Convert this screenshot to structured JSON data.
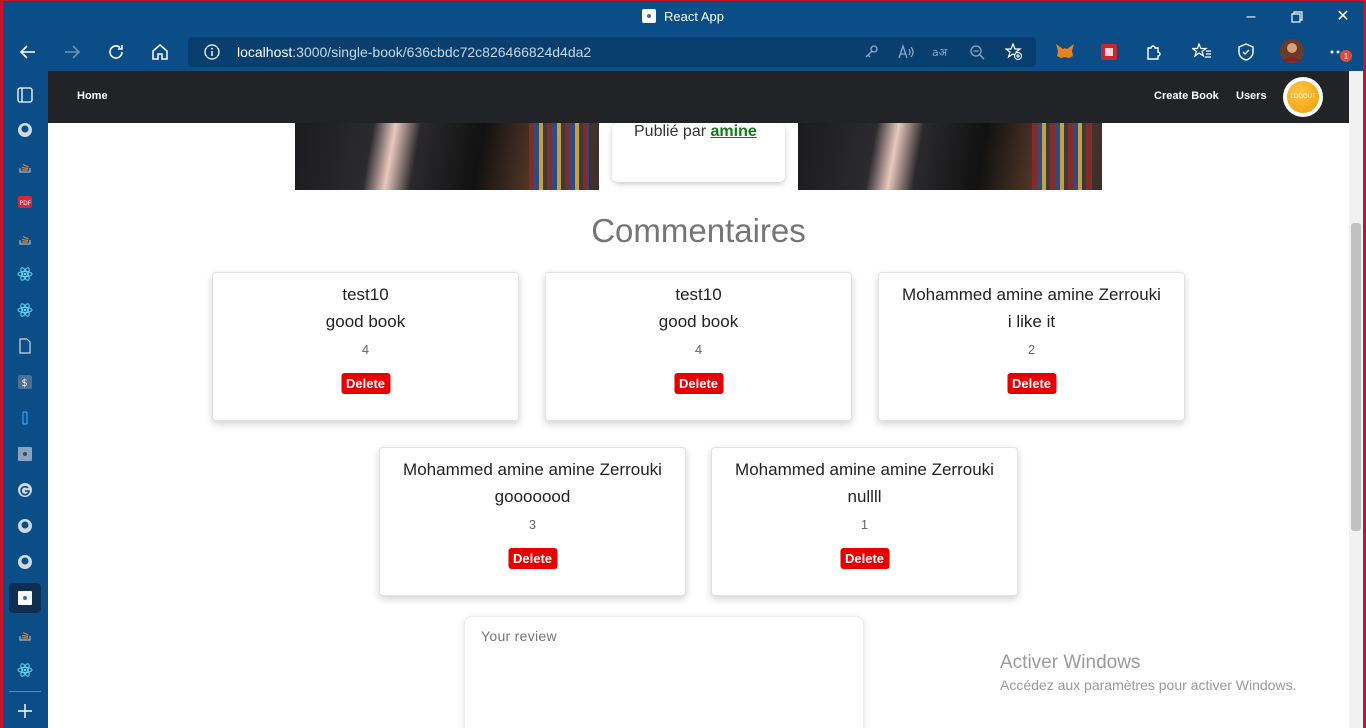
{
  "browser": {
    "window_title": "React App",
    "url_host": "localhost",
    "url_rest": ":3000/single-book/636cbdc72c826466824d4da2",
    "notification_count": "1"
  },
  "app": {
    "nav": {
      "home": "Home",
      "create_book": "Create Book",
      "users": "Users",
      "logout": "LOGOUT"
    },
    "book": {
      "published_prefix": "Publié par",
      "author": "amine"
    },
    "comments_title": "Commentaires",
    "comments": [
      {
        "author": "test10",
        "text": "good book",
        "rating": "4",
        "delete_label": "Delete"
      },
      {
        "author": "test10",
        "text": "good book",
        "rating": "4",
        "delete_label": "Delete"
      },
      {
        "author": "Mohammed amine amine Zerrouki",
        "text": "i like it",
        "rating": "2",
        "delete_label": "Delete"
      },
      {
        "author": "Mohammed amine amine Zerrouki",
        "text": "gooooood",
        "rating": "3",
        "delete_label": "Delete"
      },
      {
        "author": "Mohammed amine amine Zerrouki",
        "text": "nullll",
        "rating": "1",
        "delete_label": "Delete"
      }
    ],
    "review_placeholder": "Your review"
  },
  "watermark": {
    "line1": "Activer Windows",
    "line2": "Accédez aux paramètres pour activer Windows."
  },
  "colors": {
    "browser_chrome": "#0b4d86",
    "app_nav": "#222327",
    "delete_button": "#e60000",
    "author_link": "#0f7a15",
    "logout_button": "#f29a00"
  }
}
